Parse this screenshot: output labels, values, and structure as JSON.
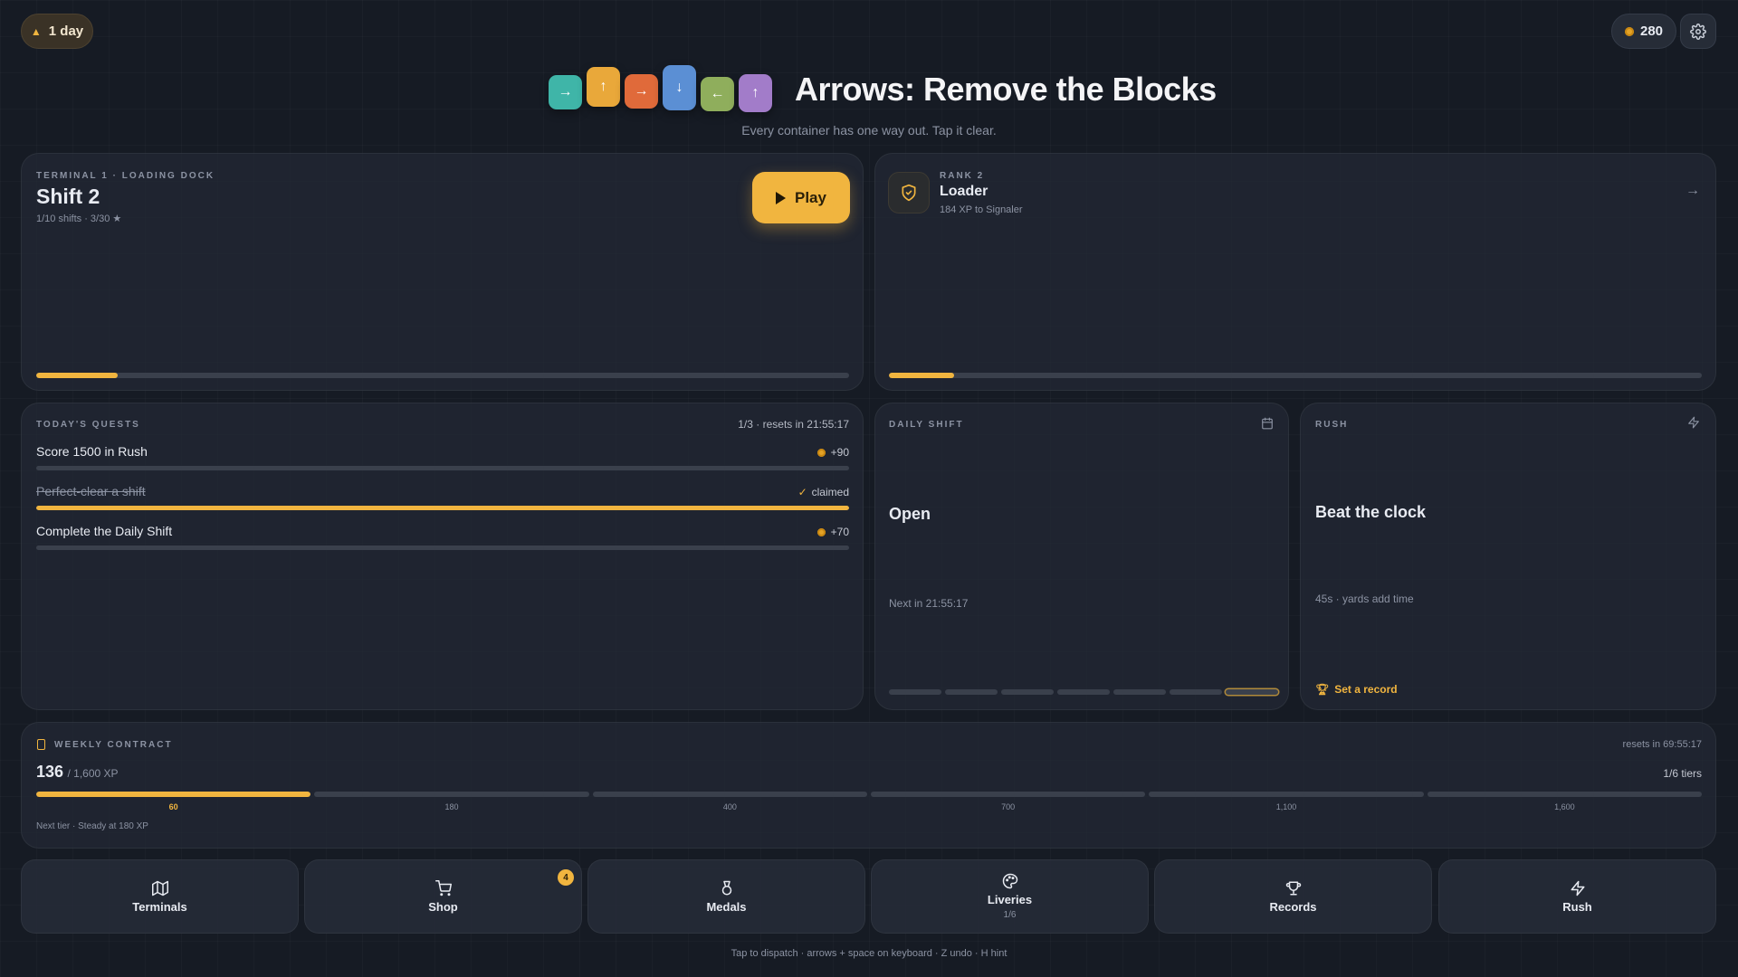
{
  "header": {
    "streak": "1 day",
    "coins": "280"
  },
  "title": {
    "text": "Arrows: Remove the Blocks",
    "subtitle": "Every container has one way out. Tap it clear.",
    "logo_blocks": [
      {
        "arrow": "→",
        "color": "#3fb5a8"
      },
      {
        "arrow": "↑",
        "color": "#e9a83a"
      },
      {
        "arrow": "→",
        "color": "#e06a3a"
      },
      {
        "arrow": "↓",
        "color": "#5b8fd4"
      },
      {
        "arrow": "←",
        "color": "#8fae5c"
      },
      {
        "arrow": "↑",
        "color": "#a27cc9"
      }
    ]
  },
  "campaign": {
    "eyebrow": "TERMINAL 1 · LOADING DOCK",
    "title": "Shift 2",
    "meta": "1/10 shifts · 3/30 ★",
    "play_label": "Play",
    "progress": 0.1
  },
  "rank": {
    "eyebrow": "RANK 2",
    "title": "Loader",
    "meta": "184 XP to Signaler",
    "progress": 0.08
  },
  "quests": {
    "eyebrow": "TODAY'S QUESTS",
    "status": "1/3 · resets in 21:55:17",
    "items": [
      {
        "name": "Score 1500 in Rush",
        "reward": "+90",
        "progress": 0,
        "done": false
      },
      {
        "name": "Perfect-clear a shift",
        "reward": "claimed",
        "progress": 1,
        "done": true
      },
      {
        "name": "Complete the Daily Shift",
        "reward": "+70",
        "progress": 0,
        "done": false
      }
    ]
  },
  "daily": {
    "eyebrow": "DAILY SHIFT",
    "title": "Open",
    "next": "Next in 21:55:17",
    "days": 7
  },
  "rush": {
    "eyebrow": "RUSH",
    "title": "Beat the clock",
    "meta": "45s · yards add time",
    "link": "Set a record"
  },
  "contract": {
    "eyebrow": "WEEKLY CONTRACT",
    "resets": "resets in 69:55:17",
    "xp": "136",
    "xp_total": "/ 1,600 XP",
    "tiers_done": "1/6 tiers",
    "tiers": [
      {
        "label": "60",
        "progress": 1
      },
      {
        "label": "180",
        "progress": 0
      },
      {
        "label": "400",
        "progress": 0
      },
      {
        "label": "700",
        "progress": 0
      },
      {
        "label": "1,100",
        "progress": 0
      },
      {
        "label": "1,600",
        "progress": 0
      }
    ],
    "next_tier": "Next tier · Steady at 180 XP"
  },
  "nav": {
    "terminals": "Terminals",
    "shop": "Shop",
    "shop_badge": "4",
    "medals": "Medals",
    "liveries": "Liveries",
    "liveries_sub": "1/6",
    "records": "Records",
    "rush": "Rush"
  },
  "footer": "Tap to dispatch · arrows + space on keyboard · Z undo · H hint",
  "colors": {
    "accent": "#f1b53f",
    "background": "#161b24",
    "panel": "#222834"
  }
}
